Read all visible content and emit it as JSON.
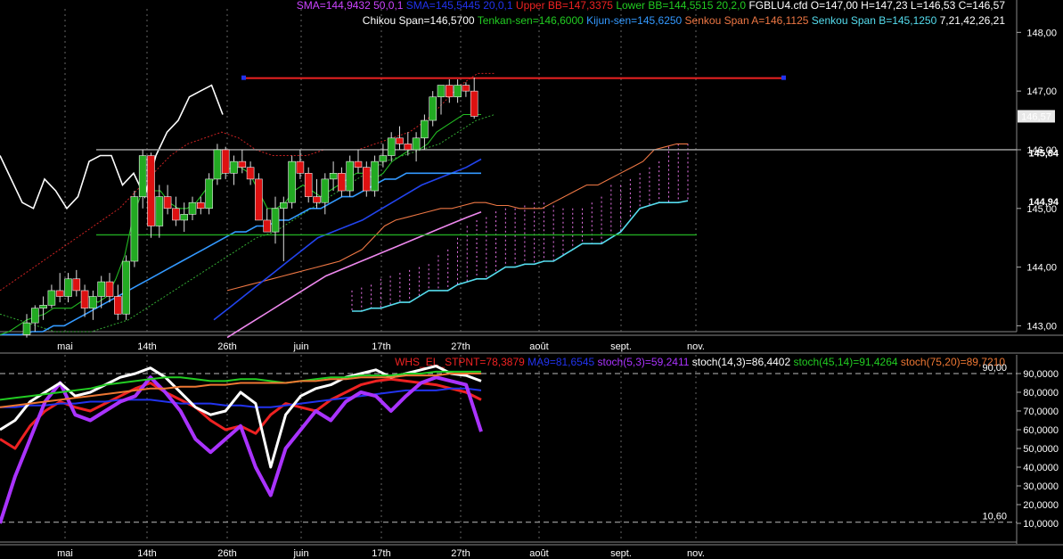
{
  "header": {
    "line1": [
      {
        "text": "SMA=144,9432  50,0,1",
        "color": "#cc44ff"
      },
      {
        "text": "SMA=145,5445  20,0,1",
        "color": "#2233ee"
      },
      {
        "text": "Upper BB=147,3375",
        "color": "#ee2222"
      },
      {
        "text": "Lower BB=144,5515  20,2,0",
        "color": "#22cc22"
      },
      {
        "text": "FGBLU4.cfd O=147,00 H=147,23 L=146,53 C=146,57",
        "color": "#ffffff"
      }
    ],
    "line2": [
      {
        "text": "Chikou Span=146,5700",
        "color": "#ffffff"
      },
      {
        "text": "Tenkan-sen=146,6000",
        "color": "#22cc22"
      },
      {
        "text": "Kijun-sen=145,6250",
        "color": "#3399ff"
      },
      {
        "text": "Senkou Span A=146,1125",
        "color": "#ee7744"
      },
      {
        "text": "Senkou Span B=145,1250",
        "color": "#55ddee"
      },
      {
        "text": "7,21,42,26,21",
        "color": "#ffffff"
      }
    ]
  },
  "lower_header": [
    {
      "text": "WHS_EL_STPNT=78,3879",
      "color": "#ee2222"
    },
    {
      "text": "MA9=81,6545",
      "color": "#2233ee"
    },
    {
      "text": "stoch(5,3)=59,2411",
      "color": "#aa33ff"
    },
    {
      "text": "stoch(14,3)=86,4402",
      "color": "#ffffff"
    },
    {
      "text": "stoch(45,14)=91,4264",
      "color": "#22cc22"
    },
    {
      "text": "stoch(75,20)=89,7210",
      "color": "#ee7733"
    }
  ],
  "price_box": {
    "last_close": "146,57",
    "kijun_label": "145,84",
    "sma_label": "144,94"
  },
  "colors": {
    "bull": "#22aa22",
    "bear": "#dd1111",
    "grid": "#666666"
  },
  "chart_data": [
    {
      "type": "candlestick",
      "title": "FGBLU4.cfd",
      "ylim": [
        142.9,
        148.4
      ],
      "y_ticks": [
        "143,00",
        "144,00",
        "145,00",
        "146,00",
        "147,00",
        "148,00"
      ],
      "x_tick_labels": [
        "mai",
        "14th",
        "26th",
        "juin",
        "17th",
        "27th",
        "août",
        "sept.",
        "nov."
      ],
      "candles": [
        [
          142.85,
          143.2,
          142.8,
          143.05
        ],
        [
          143.05,
          143.35,
          142.9,
          143.3
        ],
        [
          143.3,
          143.5,
          143.1,
          143.35
        ],
        [
          143.35,
          143.7,
          143.3,
          143.6
        ],
        [
          143.6,
          143.9,
          143.4,
          143.5
        ],
        [
          143.5,
          143.9,
          143.4,
          143.8
        ],
        [
          143.8,
          143.95,
          143.5,
          143.6
        ],
        [
          143.6,
          143.7,
          143.15,
          143.3
        ],
        [
          143.3,
          143.6,
          143.1,
          143.5
        ],
        [
          143.5,
          143.85,
          143.3,
          143.75
        ],
        [
          143.75,
          143.9,
          143.4,
          143.5
        ],
        [
          143.5,
          143.7,
          143.1,
          143.2
        ],
        [
          143.2,
          144.2,
          143.1,
          144.1
        ],
        [
          144.1,
          145.3,
          144.0,
          145.2
        ],
        [
          145.2,
          146.0,
          145.0,
          145.9
        ],
        [
          145.9,
          145.95,
          144.5,
          144.7
        ],
        [
          144.7,
          145.4,
          144.5,
          145.2
        ],
        [
          145.2,
          145.4,
          144.9,
          145.0
        ],
        [
          145.0,
          145.2,
          144.7,
          144.8
        ],
        [
          144.8,
          145.1,
          144.6,
          144.9
        ],
        [
          144.9,
          145.2,
          144.8,
          145.1
        ],
        [
          145.1,
          145.2,
          144.9,
          145.0
        ],
        [
          145.0,
          145.6,
          144.9,
          145.5
        ],
        [
          145.5,
          146.1,
          145.4,
          146.0
        ],
        [
          146.0,
          146.05,
          145.5,
          145.6
        ],
        [
          145.6,
          145.9,
          145.4,
          145.8
        ],
        [
          145.8,
          146.0,
          145.6,
          145.7
        ],
        [
          145.7,
          145.8,
          145.4,
          145.5
        ],
        [
          145.5,
          145.6,
          144.8,
          144.8
        ],
        [
          144.8,
          145.0,
          144.6,
          144.6
        ],
        [
          144.6,
          145.2,
          144.4,
          145.0
        ],
        [
          145.0,
          145.2,
          144.1,
          145.1
        ],
        [
          145.1,
          145.9,
          145.0,
          145.8
        ],
        [
          145.8,
          146.0,
          145.5,
          145.6
        ],
        [
          145.6,
          145.7,
          145.1,
          145.2
        ],
        [
          145.2,
          145.5,
          145.0,
          145.1
        ],
        [
          145.1,
          145.6,
          144.9,
          145.5
        ],
        [
          145.5,
          145.8,
          145.3,
          145.6
        ],
        [
          145.6,
          145.7,
          145.2,
          145.3
        ],
        [
          145.3,
          145.9,
          145.2,
          145.8
        ],
        [
          145.8,
          146.0,
          145.6,
          145.7
        ],
        [
          145.7,
          145.8,
          145.2,
          145.3
        ],
        [
          145.3,
          145.9,
          145.2,
          145.8
        ],
        [
          145.8,
          146.1,
          145.7,
          145.9
        ],
        [
          145.9,
          146.3,
          145.8,
          146.2
        ],
        [
          146.2,
          146.4,
          146.0,
          146.1
        ],
        [
          146.1,
          146.3,
          145.9,
          146.0
        ],
        [
          146.0,
          146.3,
          145.8,
          146.2
        ],
        [
          146.2,
          146.6,
          146.0,
          146.5
        ],
        [
          146.5,
          147.0,
          146.4,
          146.9
        ],
        [
          146.9,
          147.1,
          146.6,
          147.1
        ],
        [
          147.1,
          147.2,
          146.8,
          146.9
        ],
        [
          146.9,
          147.2,
          146.8,
          147.1
        ],
        [
          147.1,
          147.15,
          146.9,
          147.0
        ],
        [
          147.0,
          147.23,
          146.53,
          146.57
        ]
      ],
      "h_levels": [
        147.22,
        146.0,
        144.55
      ],
      "lines": {
        "chikou": [
          145.9,
          145.5,
          145.1,
          145.0,
          145.5,
          145.3,
          145.0,
          145.2,
          145.8,
          145.9,
          145.9,
          145.4,
          145.6,
          145.2,
          145.9,
          146.3,
          146.5,
          146.9,
          147.0,
          147.1,
          146.6
        ],
        "tenkan": [
          142.85,
          142.9,
          143.0,
          143.1,
          143.15,
          143.2,
          143.3,
          143.3,
          143.3,
          143.4,
          143.5,
          143.4,
          143.5,
          143.8,
          144.2,
          144.9,
          145.3,
          145.3,
          145.3,
          145.1,
          145.0,
          145.0,
          145.1,
          145.3,
          145.5,
          145.6,
          145.7,
          145.7,
          145.6,
          145.3,
          145.0,
          145.0,
          145.1,
          145.3,
          145.4,
          145.3,
          145.2,
          145.3,
          145.4,
          145.5,
          145.6,
          145.6,
          145.5,
          145.6,
          145.8,
          145.9,
          146.0,
          146.0,
          146.1,
          146.3,
          146.4,
          146.5,
          146.6,
          146.6,
          146.6
        ],
        "kijun": [
          142.85,
          142.85,
          142.85,
          142.9,
          142.9,
          143.0,
          143.0,
          143.1,
          143.2,
          143.3,
          143.4,
          143.5,
          143.6,
          143.7,
          143.8,
          143.9,
          144.0,
          144.1,
          144.2,
          144.3,
          144.4,
          144.5,
          144.6,
          144.6,
          144.7,
          144.7,
          144.8,
          144.8,
          144.9,
          145.0,
          145.0,
          145.1,
          145.2,
          145.2,
          145.3,
          145.4,
          145.5,
          145.5,
          145.6,
          145.6,
          145.6,
          145.6,
          145.6,
          145.6,
          145.6,
          145.6
        ],
        "senkou_a": [
          143.6,
          143.65,
          143.7,
          143.75,
          143.8,
          143.85,
          143.9,
          143.95,
          144.0,
          144.05,
          144.1,
          144.2,
          144.3,
          144.5,
          144.7,
          144.8,
          144.85,
          144.9,
          144.95,
          145.0,
          145.0,
          145.05,
          145.1,
          145.1,
          145.05,
          145.05,
          145.0,
          145.0,
          145.0,
          145.1,
          145.2,
          145.3,
          145.4,
          145.4,
          145.5,
          145.6,
          145.7,
          145.8,
          146.0,
          146.05,
          146.1,
          146.1
        ],
        "senkou_b": [
          143.25,
          143.25,
          143.3,
          143.3,
          143.35,
          143.4,
          143.4,
          143.5,
          143.6,
          143.6,
          143.6,
          143.7,
          143.75,
          143.8,
          143.8,
          143.9,
          144.0,
          144.0,
          144.05,
          144.05,
          144.1,
          144.1,
          144.2,
          144.3,
          144.4,
          144.4,
          144.4,
          144.5,
          144.6,
          144.8,
          145.0,
          145.05,
          145.1,
          145.1,
          145.1,
          145.13
        ],
        "upper_bb": [
          143.6,
          143.8,
          144.0,
          144.2,
          144.4,
          144.6,
          144.8,
          145.0,
          145.3,
          145.6,
          145.9,
          146.1,
          146.2,
          146.3,
          146.2,
          146.0,
          145.9,
          145.9,
          145.9,
          146.0,
          146.0,
          146.0,
          146.1,
          146.2,
          146.3,
          146.5,
          146.8,
          147.1,
          147.3,
          147.3
        ],
        "lower_bb": [
          143.2,
          143.1,
          143.0,
          142.9,
          142.9,
          142.9,
          143.0,
          143.1,
          143.3,
          143.5,
          143.7,
          143.9,
          144.1,
          144.3,
          144.5,
          144.6,
          144.8,
          145.0,
          145.2,
          145.4,
          145.6,
          145.8,
          145.9,
          146.0,
          146.1,
          146.3,
          146.5,
          146.6
        ],
        "sma50": [
          142.8,
          142.95,
          143.1,
          143.25,
          143.4,
          143.55,
          143.7,
          143.85,
          143.95,
          144.05,
          144.15,
          144.25,
          144.35,
          144.45,
          144.55,
          144.65,
          144.75,
          144.85,
          144.94
        ],
        "sma20": [
          143.1,
          143.3,
          143.5,
          143.7,
          143.9,
          144.1,
          144.3,
          144.5,
          144.6,
          144.7,
          144.8,
          144.95,
          145.1,
          145.25,
          145.4,
          145.5,
          145.6,
          145.7,
          145.84
        ]
      }
    },
    {
      "type": "line",
      "title": "Stochastics",
      "ylim": [
        0,
        100
      ],
      "y_ticks": [
        "10,0000",
        "20,0000",
        "30,0000",
        "40,0000",
        "50,0000",
        "60,0000",
        "70,0000",
        "80,0000",
        "90,0000"
      ],
      "h_levels": [
        {
          "value": 90,
          "label": "90,00"
        },
        {
          "value": 10.6,
          "label": "10,60"
        }
      ],
      "x_tick_labels": [
        "mai",
        "14th",
        "26th",
        "juin",
        "17th",
        "27th",
        "août",
        "sept.",
        "nov."
      ],
      "series": [
        {
          "name": "WHS_EL_STPNT",
          "color": "#ee2222",
          "values": [
            55,
            50,
            62,
            70,
            75,
            72,
            70,
            74,
            78,
            82,
            85,
            80,
            76,
            72,
            65,
            60,
            62,
            58,
            68,
            74,
            72,
            70,
            76,
            80,
            84,
            86,
            87,
            86,
            85,
            84,
            82,
            80,
            76
          ]
        },
        {
          "name": "MA9",
          "color": "#2233ee",
          "values": [
            72,
            72,
            73,
            73,
            74,
            74,
            75,
            75,
            76,
            76,
            76,
            75,
            74,
            74,
            74,
            73,
            73,
            72,
            72,
            73,
            74,
            75,
            76,
            77,
            78,
            79,
            80,
            81,
            81,
            81,
            82,
            82,
            81
          ]
        },
        {
          "name": "stoch(5,3)",
          "color": "#aa33ff",
          "values": [
            10,
            35,
            55,
            75,
            85,
            68,
            65,
            70,
            75,
            78,
            88,
            80,
            70,
            55,
            48,
            55,
            62,
            40,
            25,
            50,
            60,
            70,
            65,
            75,
            80,
            78,
            70,
            78,
            85,
            88,
            86,
            84,
            59
          ]
        },
        {
          "name": "stoch(14,3)",
          "color": "#ffffff",
          "values": [
            60,
            65,
            75,
            80,
            85,
            78,
            80,
            84,
            88,
            90,
            93,
            88,
            80,
            72,
            68,
            70,
            80,
            74,
            40,
            68,
            78,
            82,
            84,
            88,
            90,
            92,
            88,
            90,
            92,
            94,
            90,
            89,
            86
          ]
        },
        {
          "name": "stoch(45,14)",
          "color": "#22cc22",
          "values": [
            76,
            77,
            78,
            79,
            80,
            81,
            82,
            84,
            85,
            86,
            87,
            88,
            88,
            87,
            86,
            86,
            87,
            87,
            86,
            85,
            86,
            87,
            88,
            88,
            89,
            89,
            89,
            90,
            90,
            91,
            91,
            91,
            91
          ]
        },
        {
          "name": "stoch(75,20)",
          "color": "#ee7733",
          "values": [
            72,
            73,
            74,
            75,
            76,
            77,
            78,
            79,
            80,
            81,
            82,
            82,
            83,
            83,
            84,
            84,
            85,
            85,
            85,
            85,
            86,
            86,
            87,
            87,
            88,
            88,
            88,
            89,
            89,
            89,
            90,
            90,
            90
          ]
        }
      ]
    }
  ]
}
